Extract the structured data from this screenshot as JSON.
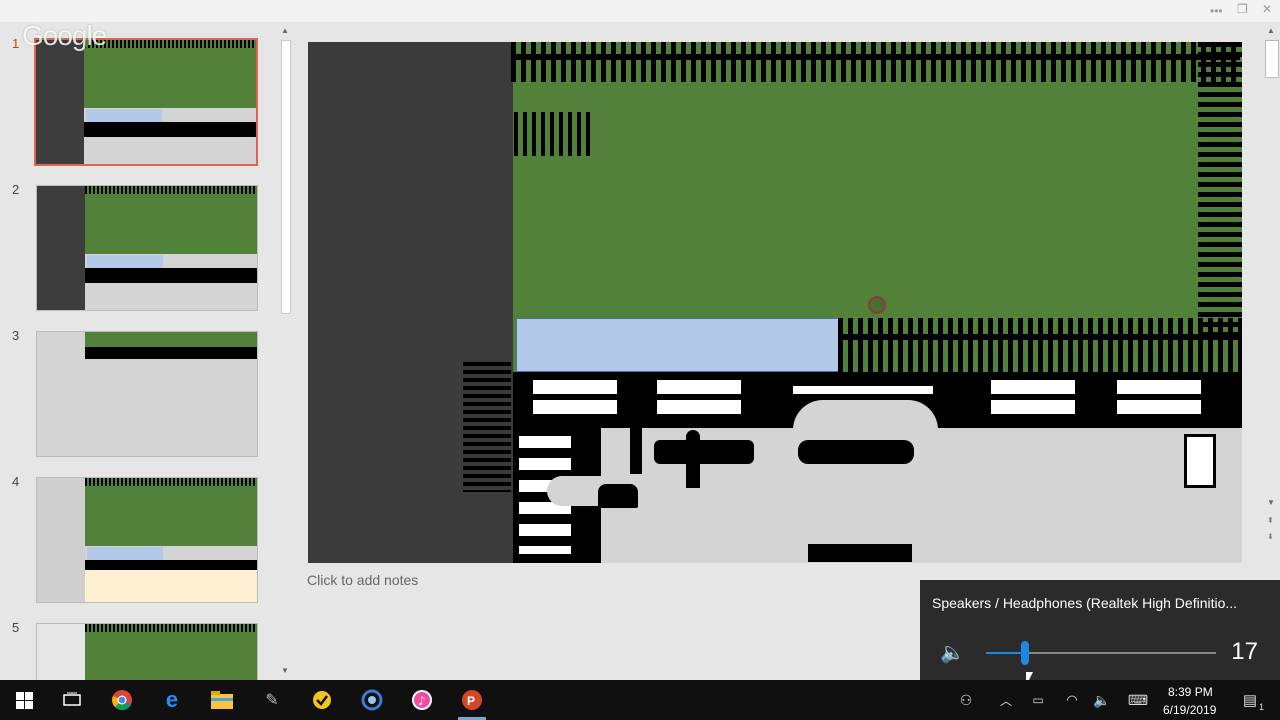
{
  "window": {
    "logo_text": "Google",
    "menu_icon": "more-dots-icon",
    "restore_icon": "restore-icon",
    "close_icon": "close-icon"
  },
  "slides": [
    {
      "number": "1",
      "selected": true,
      "variant": "garden"
    },
    {
      "number": "2",
      "selected": false,
      "variant": "garden"
    },
    {
      "number": "3",
      "selected": false,
      "variant": "cream"
    },
    {
      "number": "4",
      "selected": false,
      "variant": "garden-cream"
    },
    {
      "number": "5",
      "selected": false,
      "variant": "garden"
    }
  ],
  "editor": {
    "notes_placeholder": "Click to add notes"
  },
  "volume_flyout": {
    "device_name": "Speakers / Headphones (Realtek High Definitio...",
    "level": 17,
    "icon": "speaker-icon"
  },
  "taskbar": {
    "apps": [
      {
        "name": "start-button",
        "icon": "windows-icon"
      },
      {
        "name": "task-view-button",
        "icon": "task-view-icon"
      },
      {
        "name": "chrome-button",
        "icon": "chrome-icon"
      },
      {
        "name": "edge-button",
        "icon": "edge-icon"
      },
      {
        "name": "file-explorer-button",
        "icon": "folder-icon"
      },
      {
        "name": "paint-button",
        "icon": "paint-icon"
      },
      {
        "name": "norton-button",
        "icon": "norton-icon"
      },
      {
        "name": "app-button",
        "icon": "circle-app-icon"
      },
      {
        "name": "itunes-button",
        "icon": "itunes-icon"
      },
      {
        "name": "powerpoint-button",
        "icon": "powerpoint-icon"
      }
    ],
    "clock_time": "8:39 PM",
    "clock_date": "6/19/2019",
    "notification_count": "1"
  },
  "colors": {
    "grass": "#52823a",
    "road": "#3b3b3b",
    "pool": "#b3c9e8",
    "accent": "#1e88e5",
    "selected_border": "#e0634a"
  }
}
